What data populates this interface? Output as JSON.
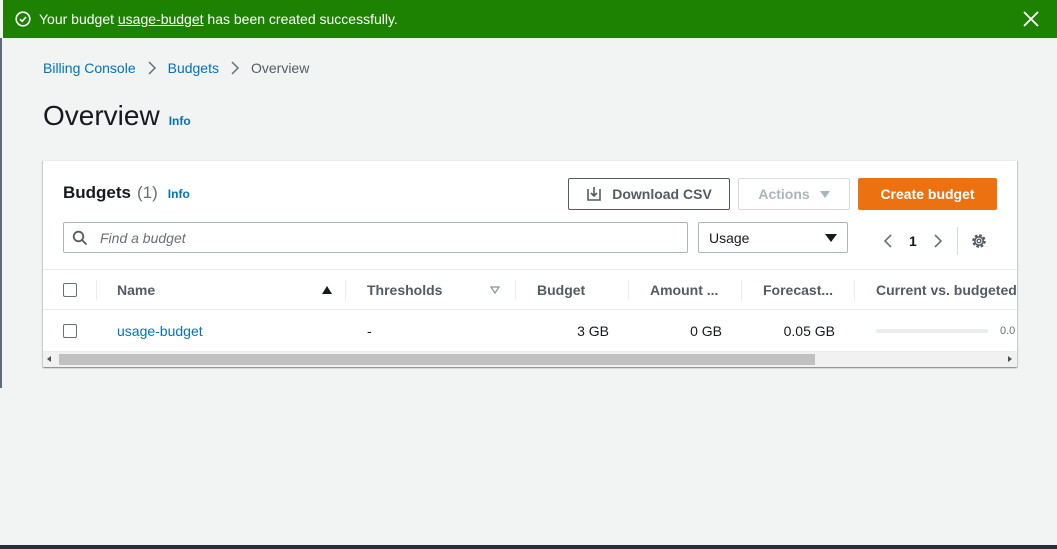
{
  "flash": {
    "message_before": "Your budget ",
    "budget_link": "usage-budget",
    "message_after": " has been created successfully.",
    "color": "#1d8102"
  },
  "breadcrumb": {
    "items": [
      "Billing Console",
      "Budgets"
    ],
    "current": "Overview"
  },
  "page": {
    "title": "Overview",
    "info": "Info"
  },
  "budgets": {
    "title": "Budgets",
    "count": "(1)",
    "info": "Info",
    "download_label": "Download CSV",
    "actions_label": "Actions",
    "create_label": "Create budget",
    "accent": "#ec7211",
    "search_placeholder": "Find a budget",
    "filter_value": "Usage",
    "page_number": "1",
    "columns": {
      "name": "Name",
      "thresholds": "Thresholds",
      "budget": "Budget",
      "amount": "Amount ...",
      "forecast": "Forecast...",
      "current_vs_budgeted": "Current vs. budgeted"
    },
    "rows": [
      {
        "name": "usage-budget",
        "thresholds": "-",
        "budget": "3 GB",
        "amount": "0 GB",
        "forecast": "0.05 GB",
        "current_vs_budgeted_text": "0.0",
        "current_vs_budgeted_fraction": 0
      }
    ]
  }
}
